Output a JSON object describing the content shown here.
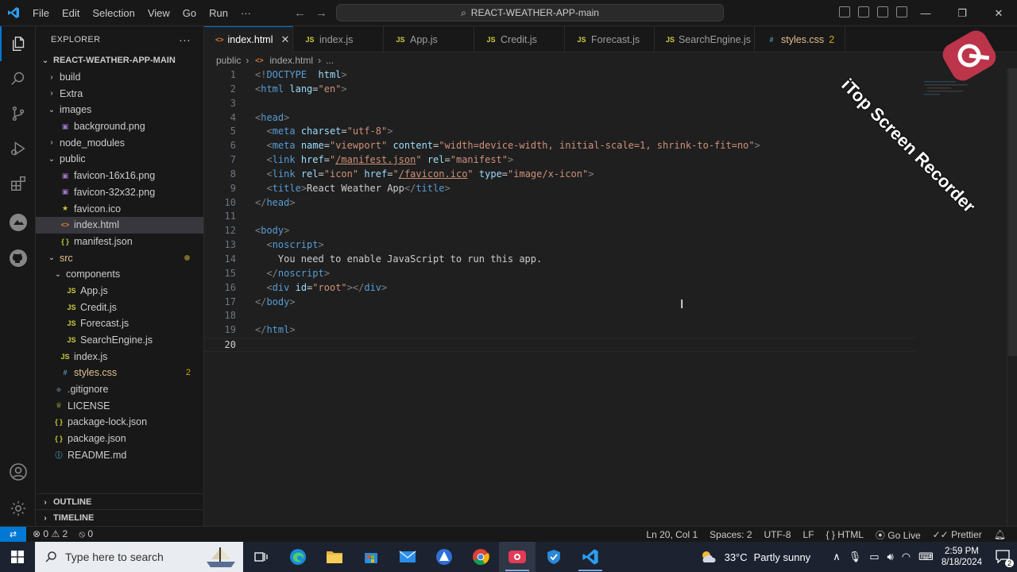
{
  "menu": [
    "File",
    "Edit",
    "Selection",
    "View",
    "Go",
    "Run",
    "···"
  ],
  "command_center": "REACT-WEATHER-APP-main",
  "explorer": {
    "title": "EXPLORER",
    "project": "REACT-WEATHER-APP-MAIN",
    "items": [
      {
        "label": "build",
        "kind": "folder-closed",
        "level": 1
      },
      {
        "label": "Extra",
        "kind": "folder-closed",
        "level": 1
      },
      {
        "label": "images",
        "kind": "folder-open",
        "level": 1
      },
      {
        "label": "background.png",
        "kind": "img",
        "level": 2
      },
      {
        "label": "node_modules",
        "kind": "folder-closed",
        "level": 1
      },
      {
        "label": "public",
        "kind": "folder-open",
        "level": 1
      },
      {
        "label": "favicon-16x16.png",
        "kind": "img",
        "level": 2
      },
      {
        "label": "favicon-32x32.png",
        "kind": "img",
        "level": 2
      },
      {
        "label": "favicon.ico",
        "kind": "star",
        "level": 2
      },
      {
        "label": "index.html",
        "kind": "html",
        "level": 2
      },
      {
        "label": "manifest.json",
        "kind": "json",
        "level": 2
      },
      {
        "label": "src",
        "kind": "folder-open",
        "level": 1
      },
      {
        "label": "components",
        "kind": "folder-open",
        "level": 2
      },
      {
        "label": "App.js",
        "kind": "js",
        "level": 3
      },
      {
        "label": "Credit.js",
        "kind": "js",
        "level": 3
      },
      {
        "label": "Forecast.js",
        "kind": "js",
        "level": 3
      },
      {
        "label": "SearchEngine.js",
        "kind": "js",
        "level": 3
      },
      {
        "label": "index.js",
        "kind": "js",
        "level": 2
      },
      {
        "label": "styles.css",
        "kind": "css",
        "level": 2,
        "badge": "2"
      },
      {
        "label": ".gitignore",
        "kind": "git",
        "level": 1
      },
      {
        "label": "LICENSE",
        "kind": "lic",
        "level": 1
      },
      {
        "label": "package-lock.json",
        "kind": "json",
        "level": 1
      },
      {
        "label": "package.json",
        "kind": "json",
        "level": 1
      },
      {
        "label": "README.md",
        "kind": "md",
        "level": 1
      }
    ],
    "outline": "OUTLINE",
    "timeline": "TIMELINE"
  },
  "tabs": [
    {
      "label": "index.html",
      "kind": "html",
      "active": true
    },
    {
      "label": "index.js",
      "kind": "js"
    },
    {
      "label": "App.js",
      "kind": "js"
    },
    {
      "label": "Credit.js",
      "kind": "js"
    },
    {
      "label": "Forecast.js",
      "kind": "js"
    },
    {
      "label": "SearchEngine.js",
      "kind": "js"
    },
    {
      "label": "styles.css",
      "kind": "css",
      "count": "2"
    }
  ],
  "breadcrumb": [
    "public",
    "index.html",
    "..."
  ],
  "code_lines": [
    "<!DOCTYPE html>",
    "<html lang=\"en\">",
    "",
    "<head>",
    "  <meta charset=\"utf-8\">",
    "  <meta name=\"viewport\" content=\"width=device-width, initial-scale=1, shrink-to-fit=no\">",
    "  <link href=\"/manifest.json\" rel=\"manifest\">",
    "  <link rel=\"icon\" href=\"/favicon.ico\" type=\"image/x-icon\">",
    "  <title>React Weather App</title>",
    "</head>",
    "",
    "<body>",
    "  <noscript>",
    "    You need to enable JavaScript to run this app.",
    "  </noscript>",
    "  <div id=\"root\"></div>",
    "</body>",
    "",
    "</html>",
    ""
  ],
  "current_line": 20,
  "status": {
    "errors": "0",
    "warnings": "2",
    "ports": "0",
    "position": "Ln 20, Col 1",
    "spaces": "Spaces: 2",
    "encoding": "UTF-8",
    "eol": "LF",
    "language": "HTML",
    "golive": "Go Live",
    "prettier": "Prettier"
  },
  "taskbar": {
    "search_placeholder": "Type here to search",
    "weather_temp": "33°C",
    "weather_desc": "Partly sunny",
    "time": "2:59 PM",
    "date": "8/18/2024",
    "notif_count": "2"
  },
  "watermark": "iTop Screen Recorder",
  "colors": {
    "accent": "#0078d4",
    "tag": "#569cd6",
    "attr": "#9cdcfe",
    "string": "#ce9178"
  }
}
